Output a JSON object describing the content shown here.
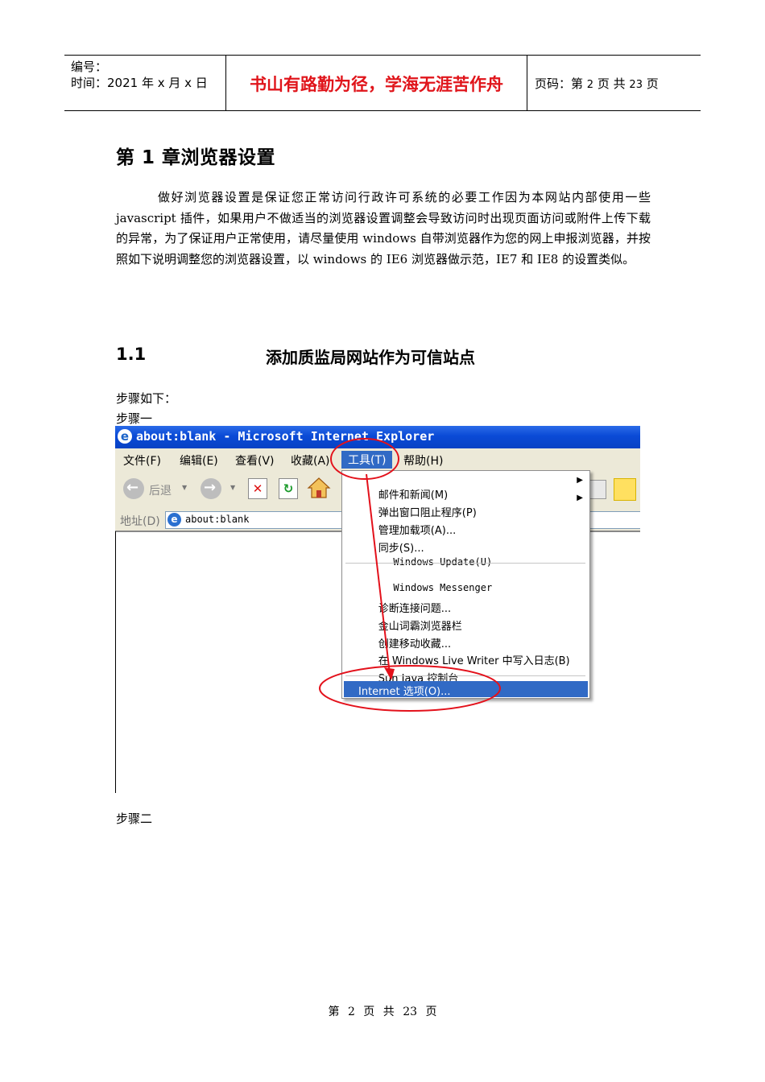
{
  "header": {
    "number_label": "编号：",
    "time_label": "时间：2021 年 x 月 x 日",
    "motto": "书山有路勤为径，学海无涯苦作舟",
    "page_prefix": "页码：第",
    "page_current": "2",
    "page_mid": "页  共",
    "page_total": "23",
    "page_suffix": "页"
  },
  "chapter_title": "第  1 章浏览器设置",
  "intro_paragraph": "做好浏览器设置是保证您正常访问行政许可系统的必要工作因为本网站内部使用一些 javascript 插件，如果用户不做适当的浏览器设置调整会导致访问时出现页面访问或附件上传下载的异常，为了保证用户正常使用，请尽量使用 windows 自带浏览器作为您的网上申报浏览器，并按照如下说明调整您的浏览器设置，以 windows 的 IE6 浏览器做示范，IE7 和 IE8 的设置类似。",
  "section": {
    "number": "1.1",
    "title": "添加质监局网站作为可信站点"
  },
  "steps_intro": "步骤如下：",
  "step1_label": "步骤一",
  "step2_label": "步骤二",
  "screenshot": {
    "window_title": "about:blank - Microsoft Internet Explorer",
    "menus": [
      "文件(F)",
      "编辑(E)",
      "查看(V)",
      "收藏(A)",
      "工具(T)",
      "帮助(H)"
    ],
    "active_menu": "工具(T)",
    "back_label": "后退",
    "address_label": "地址(D)",
    "address_value": "about:blank",
    "tools_menu": [
      "邮件和新闻(M)",
      "弹出窗口阻止程序(P)",
      "管理加载项(A)...",
      "同步(S)...",
      "Windows Update(U)",
      "Windows Messenger",
      "诊断连接问题...",
      "金山词霸浏览器栏",
      "创建移动收藏...",
      "在 Windows Live Writer 中写入日志(B)",
      "Sun Java 控制台",
      "Internet 选项(O)..."
    ],
    "highlight_color": "#e3111b"
  },
  "footer": "第 2 页 共 23 页"
}
